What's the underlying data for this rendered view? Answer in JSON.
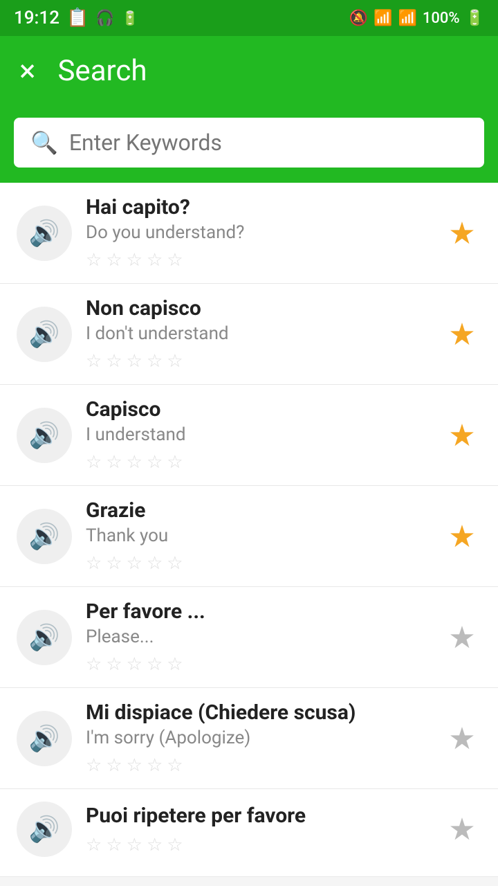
{
  "statusBar": {
    "time": "19:12",
    "batteryPercent": "100%"
  },
  "header": {
    "closeLabel": "×",
    "title": "Search"
  },
  "searchBar": {
    "placeholder": "Enter Keywords"
  },
  "phrases": [
    {
      "id": 1,
      "original": "Hai capito?",
      "translation": "Do you understand?",
      "favorited": true
    },
    {
      "id": 2,
      "original": "Non capisco",
      "translation": "I don't understand",
      "favorited": true
    },
    {
      "id": 3,
      "original": "Capisco",
      "translation": "I understand",
      "favorited": true
    },
    {
      "id": 4,
      "original": "Grazie",
      "translation": "Thank you",
      "favorited": true
    },
    {
      "id": 5,
      "original": "Per favore ...",
      "translation": "Please...",
      "favorited": false
    },
    {
      "id": 6,
      "original": "Mi dispiace (Chiedere scusa)",
      "translation": "I'm sorry (Apologize)",
      "favorited": false
    },
    {
      "id": 7,
      "original": "Puoi ripetere per favore",
      "translation": "",
      "favorited": false,
      "partial": true
    }
  ]
}
